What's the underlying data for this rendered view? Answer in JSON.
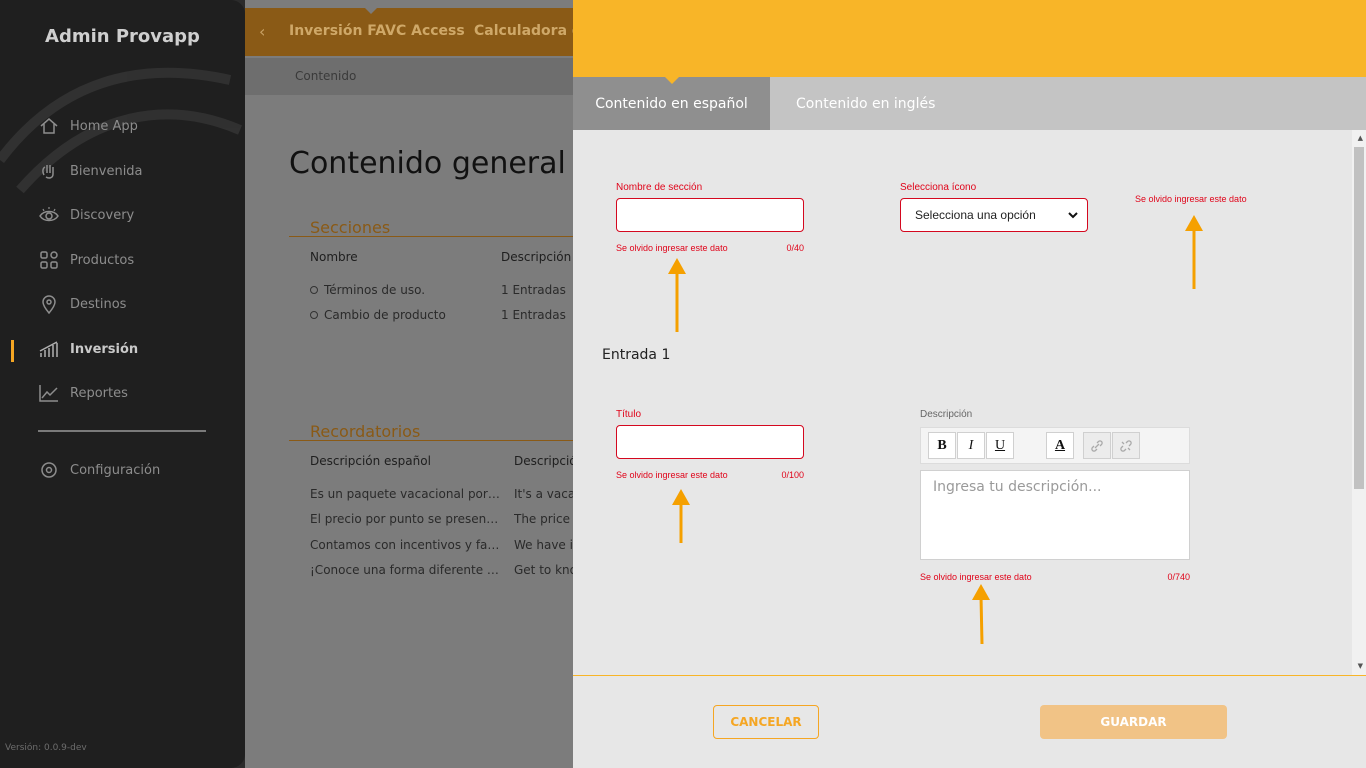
{
  "sidebar": {
    "brand": "Admin Provapp",
    "items": [
      {
        "label": "Home App",
        "icon": "home-icon"
      },
      {
        "label": "Bienvenida",
        "icon": "wave-hand-icon"
      },
      {
        "label": "Discovery",
        "icon": "eye-icon"
      },
      {
        "label": "Productos",
        "icon": "grid-icon"
      },
      {
        "label": "Destinos",
        "icon": "location-pin-icon"
      },
      {
        "label": "Inversión",
        "icon": "bar-chart-icon"
      },
      {
        "label": "Reportes",
        "icon": "line-chart-icon"
      }
    ],
    "settings": {
      "label": "Configuración",
      "icon": "gear-icon"
    },
    "active": "Inversión",
    "version": "Versión: 0.0.9-dev"
  },
  "main": {
    "tabs": [
      "Inversión FAVC Access",
      "Calculadora de"
    ],
    "breadcrumb": "Contenido",
    "page_title": "Contenido general",
    "sections": {
      "title": "Secciones",
      "headers": [
        "Nombre",
        "Descripción"
      ],
      "rows": [
        {
          "name": "Términos de uso.",
          "desc": "1 Entradas"
        },
        {
          "name": "Cambio de producto",
          "desc": "1 Entradas"
        }
      ]
    },
    "reminders": {
      "title": "Recordatorios",
      "headers": [
        "Descripción español",
        "Descripción"
      ],
      "rows": [
        {
          "es": "Es un paquete vacacional por…",
          "en": "It's a vaca"
        },
        {
          "es": "El precio por punto se presen…",
          "en": "The price p"
        },
        {
          "es": "Contamos con incentivos y fa…",
          "en": "We have in"
        },
        {
          "es": "¡Conoce una forma diferente …",
          "en": "Get to kno"
        }
      ]
    }
  },
  "panel": {
    "tabs": {
      "active": "Contenido en español",
      "inactive": "Contenido en inglés"
    },
    "section_name": {
      "label": "Nombre de sección",
      "value": "",
      "error": "Se olvido ingresar este dato",
      "counter": "0/40"
    },
    "icon_select": {
      "label": "Selecciona ícono",
      "value": "Selecciona una opción",
      "error": "Se olvido ingresar este dato"
    },
    "entry_title": "Entrada 1",
    "title_field": {
      "label": "Título",
      "value": "",
      "error": "Se olvido ingresar este dato",
      "counter": "0/100"
    },
    "description": {
      "label": "Descripción",
      "toolbar": [
        "B",
        "I",
        "U",
        "A"
      ],
      "placeholder": "Ingresa tu descripción...",
      "error": "Se olvido ingresar este dato",
      "counter": "0/740"
    },
    "buttons": {
      "cancel": "CANCELAR",
      "save": "GUARDAR"
    },
    "colors": {
      "accent": "#f8b528",
      "error": "#e0041a",
      "arrow": "#f5a000"
    }
  }
}
